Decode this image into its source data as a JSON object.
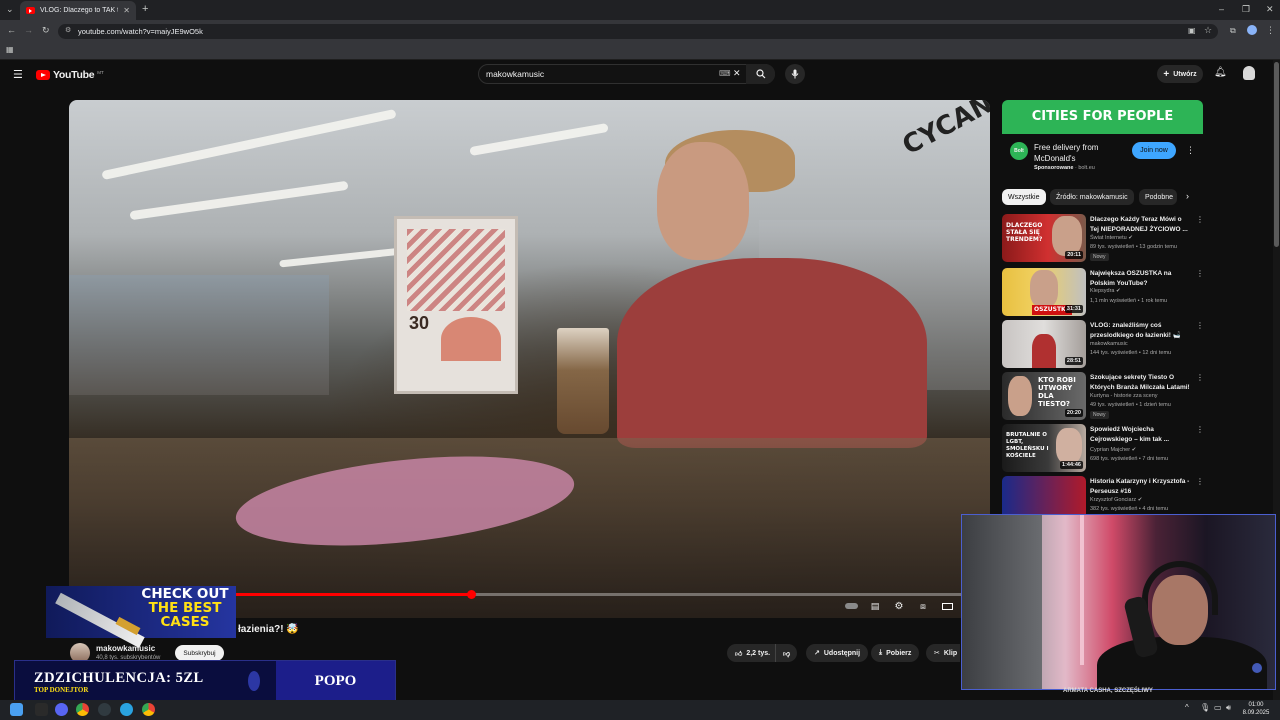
{
  "browser": {
    "tab_title": "VLOG: Dlaczego to TAK trudne",
    "url": "youtube.com/watch?v=maiyJE9wO5k"
  },
  "youtube": {
    "logo_text": "YouTube",
    "region": "MT",
    "search_value": "makowkamusic",
    "create_label": "Utwórz"
  },
  "video": {
    "title_fragment": "łazienia?! 🤯",
    "channel": "makowkamusic",
    "subscribers": "40,8 tys. subskrybentów",
    "subscribe_label": "Subskrybuj",
    "likes": "2,2 tys.",
    "share_label": "Udostępnij",
    "download_label": "Pobierz",
    "clip_label": "Klip",
    "progress": 0.437,
    "poster_text": "30"
  },
  "ad": {
    "banner": "CITIES FOR PEOPLE",
    "logo": "Bolt",
    "title": "Free delivery from McDonald's",
    "sponsored": "Sponsorowane",
    "domain": "bolt.eu",
    "cta": "Join now"
  },
  "chips": [
    "Wszystkie",
    "Źródło: makowkamusic",
    "Podobne"
  ],
  "recommendations": [
    {
      "title": "Dlaczego Każdy Teraz Mówi o Tej NIEPORADNEJ ŻYCIOWO ...",
      "channel": "Świat Internetu",
      "stats": "89 tys. wyświetleń • 13 godzin temu",
      "badge": "Nowy",
      "duration": "20:11",
      "thumb_text": "DLACZEGO STAŁA SIĘ TRENDEM?"
    },
    {
      "title": "Największa OSZUSTKA na Polskim YouTube?",
      "channel": "Klepsydra",
      "stats": "1,1 mln wyświetleń • 1 rok temu",
      "badge": "",
      "duration": "31:31",
      "thumb_text": "OSZUSTKA"
    },
    {
      "title": "VLOG: znaleźliśmy coś przeslodkiego do łazienki! 🛁",
      "channel": "makowkamusic",
      "stats": "144 tys. wyświetleń • 12 dni temu",
      "badge": "",
      "duration": "28:51",
      "thumb_text": ""
    },
    {
      "title": "Szokujące sekrety Tiesto O Których Branża Milczała Latami!",
      "channel": "Kurtyna - historie zza sceny",
      "stats": "49 tys. wyświetleń • 1 dzień temu",
      "badge": "Nowy",
      "duration": "20:20",
      "thumb_text": "KTO ROBI UTWORY DLA TIESTO?"
    },
    {
      "title": "Spowiedź Wojciecha Cejrowskiego – kim tak ...",
      "channel": "Cyprian Majcher",
      "stats": "698 tys. wyświetleń • 7 dni temu",
      "badge": "",
      "duration": "1:44:46",
      "thumb_text": "BRUTALNIE O LGBT, SMOLEŃSKU I KOŚCIELE"
    },
    {
      "title": "Historia Katarzyny i Krzysztofa - Perseusz #16",
      "channel": "Krzysztof Gonciarz",
      "stats": "382 tys. wyświetleń • 4 dni temu",
      "badge": "",
      "duration": "",
      "thumb_text": ""
    }
  ],
  "overlay": {
    "promo_line1": "CHECK OUT",
    "promo_line2": "THE BEST",
    "promo_line3": "CASES",
    "donation": "ZDZICHULENCJA: 5ZL",
    "donor_label": "TOP DONEJTOR",
    "donor_name": "POPO",
    "bottom_peek": "ARMATA CASHA, SZCZĘŚLIWY"
  },
  "taskbar": {
    "time": "01:00",
    "date": "8.09.2025"
  },
  "colors": {
    "youtube_red": "#ff0000",
    "ad_green": "#2db456",
    "join_blue": "#3ea6ff",
    "donor_yellow": "#ffe014"
  }
}
